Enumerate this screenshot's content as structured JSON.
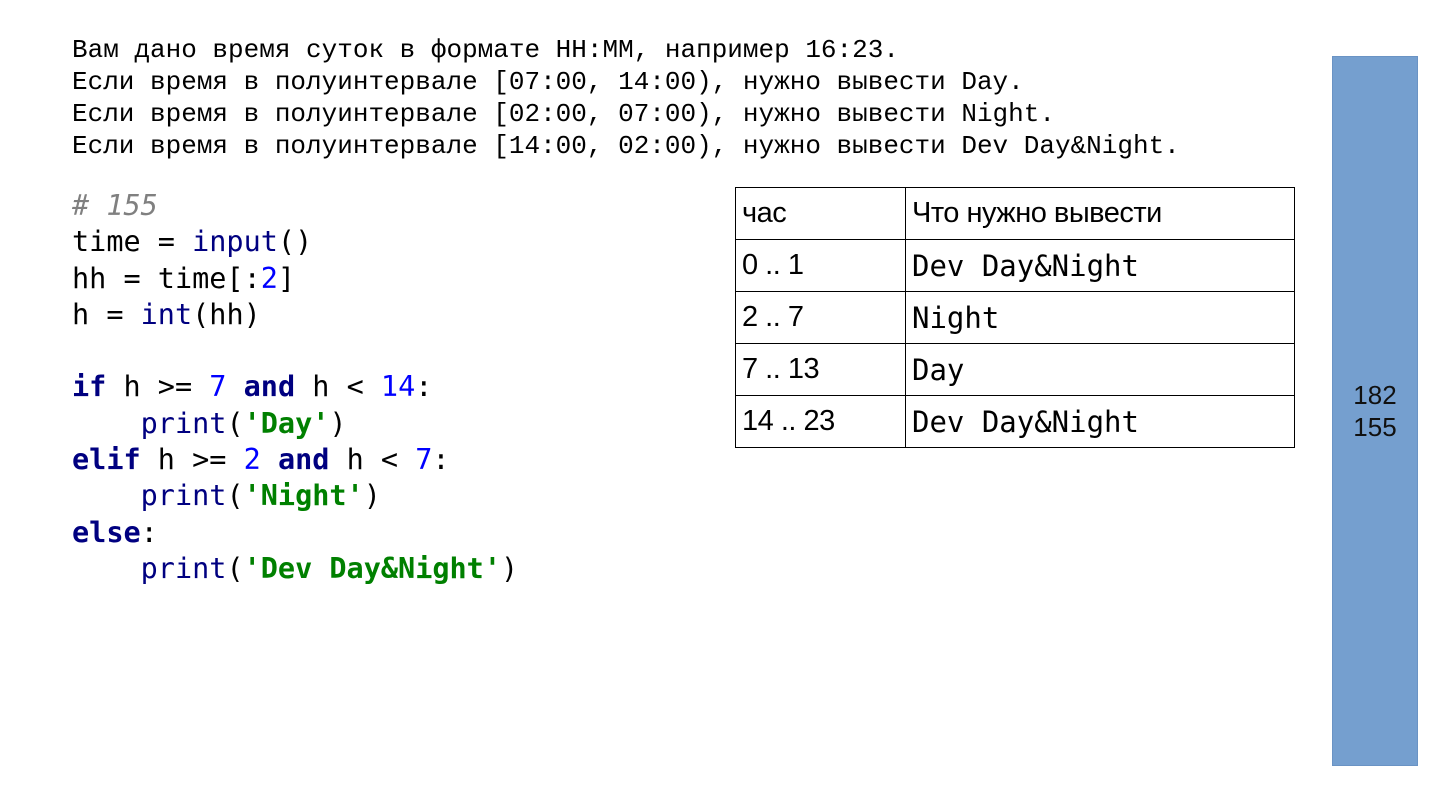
{
  "task": {
    "lines": [
      "Вам дано время суток в формате HH:MM, например 16:23.",
      "Если время в полуинтервале [07:00, 14:00), нужно вывести Day.",
      "Если время в полуинтервале [02:00, 07:00), нужно вывести Night.",
      "Если время в полуинтервале [14:00, 02:00), нужно вывести Dev Day&Night."
    ]
  },
  "code": {
    "lines": [
      [
        {
          "t": "comment",
          "v": "# 155"
        }
      ],
      [
        {
          "t": "plain",
          "v": "time = "
        },
        {
          "t": "builtin",
          "v": "input"
        },
        {
          "t": "plain",
          "v": "()"
        }
      ],
      [
        {
          "t": "plain",
          "v": "hh = time[:"
        },
        {
          "t": "number",
          "v": "2"
        },
        {
          "t": "plain",
          "v": "]"
        }
      ],
      [
        {
          "t": "plain",
          "v": "h = "
        },
        {
          "t": "builtin",
          "v": "int"
        },
        {
          "t": "plain",
          "v": "(hh)"
        }
      ],
      [],
      [
        {
          "t": "keyword",
          "v": "if"
        },
        {
          "t": "plain",
          "v": " h >= "
        },
        {
          "t": "number",
          "v": "7"
        },
        {
          "t": "plain",
          "v": " "
        },
        {
          "t": "keyword",
          "v": "and"
        },
        {
          "t": "plain",
          "v": " h < "
        },
        {
          "t": "number",
          "v": "14"
        },
        {
          "t": "plain",
          "v": ":"
        }
      ],
      [
        {
          "t": "plain",
          "v": "    "
        },
        {
          "t": "builtin",
          "v": "print"
        },
        {
          "t": "plain",
          "v": "("
        },
        {
          "t": "string",
          "v": "'Day'"
        },
        {
          "t": "plain",
          "v": ")"
        }
      ],
      [
        {
          "t": "keyword",
          "v": "elif"
        },
        {
          "t": "plain",
          "v": " h >= "
        },
        {
          "t": "number",
          "v": "2"
        },
        {
          "t": "plain",
          "v": " "
        },
        {
          "t": "keyword",
          "v": "and"
        },
        {
          "t": "plain",
          "v": " h < "
        },
        {
          "t": "number",
          "v": "7"
        },
        {
          "t": "plain",
          "v": ":"
        }
      ],
      [
        {
          "t": "plain",
          "v": "    "
        },
        {
          "t": "builtin",
          "v": "print"
        },
        {
          "t": "plain",
          "v": "("
        },
        {
          "t": "string",
          "v": "'Night'"
        },
        {
          "t": "plain",
          "v": ")"
        }
      ],
      [
        {
          "t": "keyword",
          "v": "else"
        },
        {
          "t": "plain",
          "v": ":"
        }
      ],
      [
        {
          "t": "plain",
          "v": "    "
        },
        {
          "t": "builtin",
          "v": "print"
        },
        {
          "t": "plain",
          "v": "("
        },
        {
          "t": "string",
          "v": "'Dev Day&Night'"
        },
        {
          "t": "plain",
          "v": ")"
        }
      ]
    ]
  },
  "table": {
    "header": {
      "hour": "час",
      "output": "Что нужно вывести"
    },
    "rows": [
      {
        "hour": "0 .. 1",
        "output": "Dev Day&Night"
      },
      {
        "hour": "2 .. 7",
        "output": "Night"
      },
      {
        "hour": "7 .. 13",
        "output": "Day"
      },
      {
        "hour": "14 .. 23",
        "output": "Dev Day&Night"
      }
    ]
  },
  "side": {
    "num1": "182",
    "num2": "155"
  },
  "colors": {
    "panel": "#759fcf",
    "comment": "#808080",
    "keyword": "#000080",
    "number": "#0000ff",
    "string": "#008000"
  }
}
